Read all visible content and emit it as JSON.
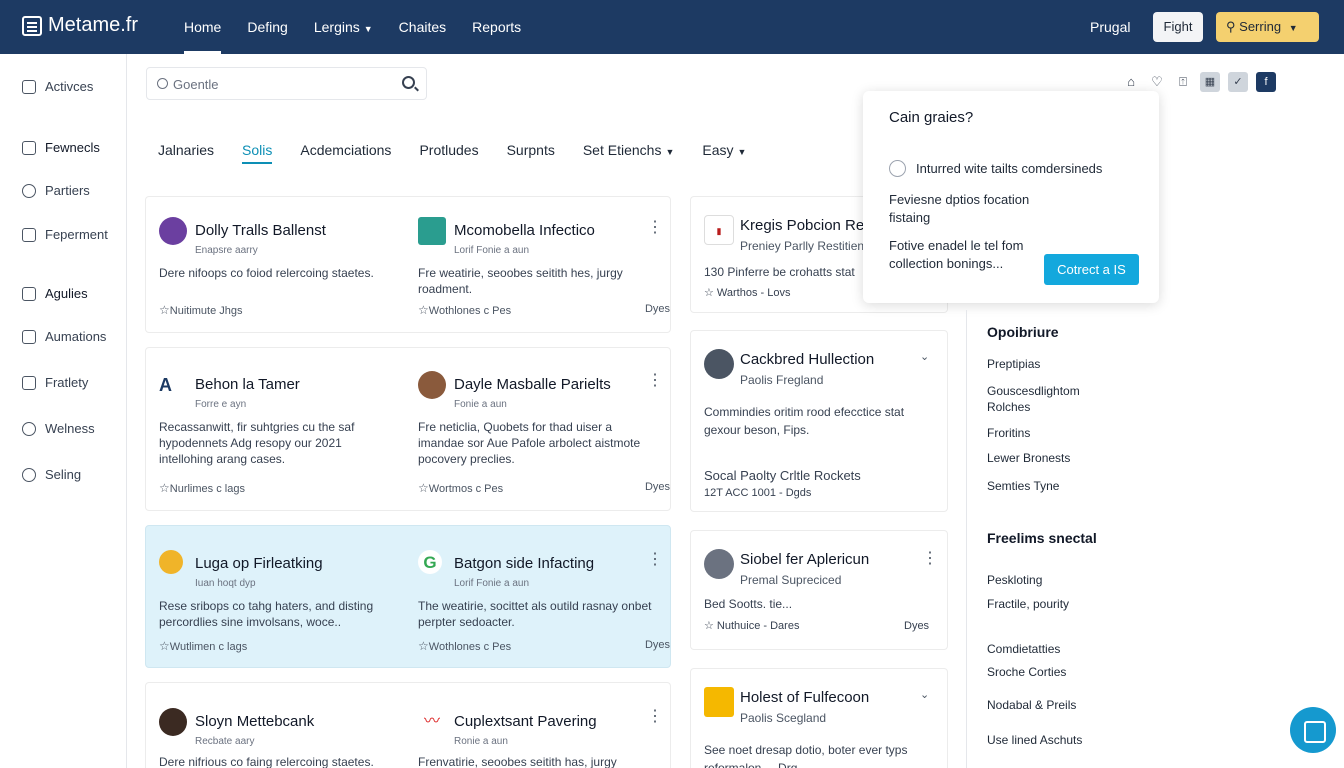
{
  "app": {
    "title": "Metame.fr"
  },
  "nav": {
    "items": [
      "Home",
      "Defing",
      "Lergins",
      "Chaites",
      "Reports"
    ],
    "active": "Home"
  },
  "topbar": {
    "user": "Prugal",
    "light_button": "Fight",
    "primary_button": "Serring"
  },
  "sidebar": {
    "items": [
      "Activces",
      "Fewnecls",
      "Partiers",
      "Feperment",
      "Agulies",
      "Aumations",
      "Fratlety",
      "Welness",
      "Seling"
    ]
  },
  "search": {
    "value": "Goentle"
  },
  "tabs": [
    "Jalnaries",
    "Solis",
    "Acdemciations",
    "Protludes",
    "Surpnts",
    "Set Etienchs",
    "Easy"
  ],
  "cards": [
    {
      "entries": [
        {
          "title": "Dolly Tralls Ballenst",
          "subtitle": "Enapsre aarry",
          "desc": "Dere nifoops co foiod relercoing staetes.",
          "meta": "Nuitimute Jhgs",
          "right": ""
        },
        {
          "title": "Mcomobella Infectico",
          "subtitle": "Lorif Fonie a aun",
          "desc": "Fre weatirie, seoobes seitith hes, jurgy roadment.",
          "meta": "Wothlones c Pes",
          "right": "Dyes"
        }
      ]
    },
    {
      "entries": [
        {
          "title": "Behon la Tamer",
          "subtitle": "Forre e ayn",
          "desc": "Recassanwitt, fir suhtgries cu the saf hypodennets Adg resopy our 2021 intellohing arang cases.",
          "meta": "Nurlimes c lags",
          "right": ""
        },
        {
          "title": "Dayle Masballe Parielts",
          "subtitle": "Fonie a aun",
          "desc": "Fre neticlia, Quobets for thad uiser a imandae sor Aue Pafole arbolect aistmote pocovery preclies.",
          "meta": "Wortmos c Pes",
          "right": "Dyes"
        }
      ]
    },
    {
      "entries": [
        {
          "title": "Luga op Firleatking",
          "subtitle": "Iuan hoqt dyp",
          "desc": "Rese sribops co tahg haters, and disting percordlies sine imvolsans, woce..",
          "meta": "Wutlimen c lags",
          "right": ""
        },
        {
          "title": "Batgon side Infacting",
          "subtitle": "Lorif Fonie a aun",
          "desc": "The weatirie, socittet als outild rasnay onbet perpter sedoacter.",
          "meta": "Wothlones c Pes",
          "right": "Dyes"
        }
      ]
    },
    {
      "entries": [
        {
          "title": "Sloyn Mettebcank",
          "subtitle": "Recbate aary",
          "desc": "Dere nifrious co faing relercoing staetes.",
          "meta": "",
          "right": ""
        },
        {
          "title": "Cuplextsant Pavering",
          "subtitle": "Ronie a aun",
          "desc": "Frenvatirie, seoobes seitith has, jurgy",
          "meta": "",
          "right": ""
        }
      ]
    }
  ],
  "right_cards": [
    {
      "title": "Kregis Pobcion Re",
      "subtitle": "Preniey Parlly Restitien",
      "line1": "130 Pinferre be crohatts stat",
      "line2": "Warthos - Lovs"
    },
    {
      "title": "Cackbred Hullection",
      "subtitle": "Paolis Fregland",
      "line1": "Commindies oritim rood efecctice stat gexour beson, Fips.",
      "line2": "Socal Paolty Crltle Rockets",
      "line3": "12T ACC 1001 - Dgds"
    },
    {
      "title": "Siobel fer Aplericun",
      "subtitle": "Premal Supreciced",
      "line1": "Bed Sootts. tie...",
      "line2": "Nuthuice - Dares",
      "right": "Dyes"
    },
    {
      "title": "Holest of Fulfecoon",
      "subtitle": "Paolis Scegland",
      "line1": "See noet dresap dotio, boter ever typs",
      "line2": "reformalon ... Drg"
    }
  ],
  "popup": {
    "question": "Cain graies?",
    "option": "Inturred wite tailts comdersineds",
    "text1": "Feviesne dptios focation fistaing",
    "text2": "Fotive enadel le tel fom collection bonings...",
    "cta": "Cotrect a IS"
  },
  "right_sidebar": {
    "heading1": "Opoibriure",
    "group1": [
      "Preptipias",
      "Gouscesdlightom Rolches",
      "Froritins",
      "Lewer Bronests",
      "Semties Tyne"
    ],
    "heading2": "Freelims snectal",
    "group2": [
      "Peskloting",
      "Fractile, pourity",
      "Comdietatties",
      "Sroche Corties",
      "Nodabal & Preils",
      "Use lined Aschuts"
    ]
  }
}
